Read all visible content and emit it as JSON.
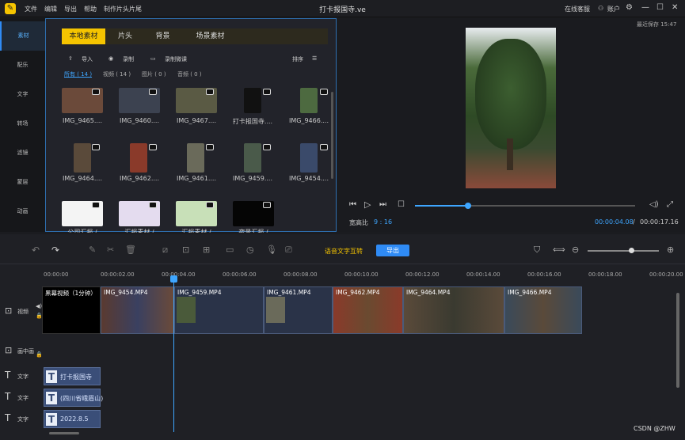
{
  "app": {
    "title": "打卡报国寺.ve",
    "menu": [
      "文件",
      "编辑",
      "导出",
      "帮助",
      "制作片头片尾"
    ],
    "service": "在线客服",
    "account": "账户"
  },
  "nav": [
    "素材",
    "配乐",
    "文字",
    "转场",
    "滤镜",
    "蒙层",
    "动画"
  ],
  "lib": {
    "tabs": [
      "本地素材",
      "片头",
      "背景",
      "场景素材"
    ],
    "import": "导入",
    "record": "录制",
    "record_course": "录制微课",
    "sort": "排序",
    "filters": [
      "所有 ( 14 )",
      "视频 ( 14 )",
      "图片 ( 0 )",
      "音频 ( 0 )"
    ],
    "items": [
      "IMG_9465....",
      "IMG_9460....",
      "IMG_9467....",
      "打卡报国寺....",
      "IMG_9466....",
      "IMG_9464....",
      "IMG_9462....",
      "IMG_9461....",
      "IMG_9459....",
      "IMG_9454....",
      "公司汇报 /",
      "汇报素材 /",
      "汇报素材 /",
      "夜景汇报 /"
    ]
  },
  "preview": {
    "autosave": "最近保存 15:47",
    "ratio_label": "宽高比",
    "ratio": "9 : 16",
    "current": "00:00:04.08",
    "total": "00:00:17.16",
    "progress": 0.24
  },
  "timeline": {
    "speech": "语音文字互转",
    "export": "导出",
    "ticks": [
      "00:00:00",
      "00:00:02.00",
      "00:00:04.00",
      "00:00:06.00",
      "00:00:08.00",
      "00:00:10.00",
      "00:00:12.00",
      "00:00:14.00",
      "00:00:16.00",
      "00:00:18.00",
      "00:00:20.00"
    ],
    "video_label": "视频",
    "pip_label": "画中画",
    "text_label": "文字",
    "clips": [
      "黑幕视频（1分钟）",
      "IMG_9454.MP4",
      "IMG_9459.MP4",
      "IMG_9461.MP4",
      "IMG_9462.MP4",
      "IMG_9464.MP4",
      "IMG_9466.MP4"
    ],
    "texts": [
      "打卡报国寺",
      "(四川省峨眉山)",
      "2022.8.5"
    ]
  },
  "watermark": "CSDN @ZHW",
  "colors": {
    "accent": "#f5c400",
    "export": "#2f8bf5",
    "playhead": "#3ea6ff"
  }
}
